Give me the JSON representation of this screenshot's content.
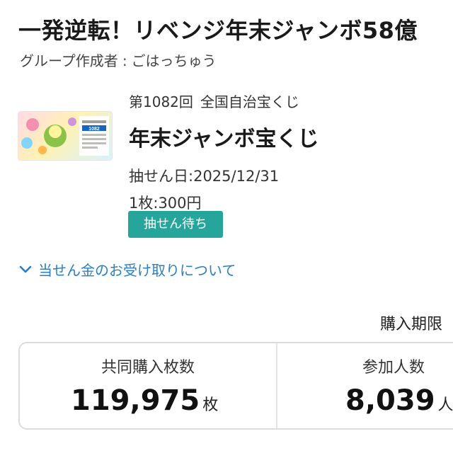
{
  "group": {
    "title": "一発逆転！リベンジ年末ジャンボ58億",
    "creator_label": "グループ作成者",
    "creator_separator": ":",
    "creator_name": "ごはっちゅう"
  },
  "lottery": {
    "round": "第1082回",
    "category": "全国自治宝くじ",
    "name": "年末ジャンボ宝くじ",
    "draw_date_label": "抽せん日:",
    "draw_date": "2025/12/31",
    "price_label": "1枚:",
    "price": "300円",
    "status": "抽せん待ち",
    "ticket_number": "1082"
  },
  "prize_info": {
    "label": "当せん金のお受け取りについて",
    "icon": "chevron-down-icon",
    "color": "#2a7fc1"
  },
  "stats": {
    "period_label": "購入期限",
    "tickets_label": "共同購入枚数",
    "tickets_value": "119,975",
    "tickets_unit": "枚",
    "participants_label": "参加人数",
    "participants_value": "8,039",
    "participants_unit": "人"
  },
  "colors": {
    "status_badge": "#26a69a",
    "link": "#2a7fc1",
    "card_border": "#dcdcdc"
  }
}
